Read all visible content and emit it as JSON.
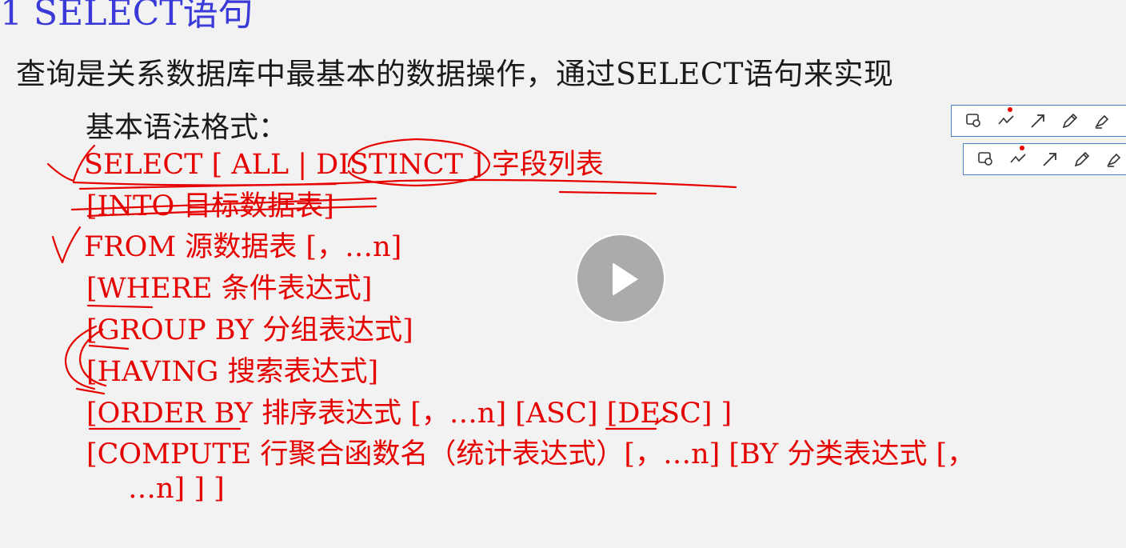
{
  "slide": {
    "title": "1 SELECT语句",
    "intro": "查询是关系数据库中最基本的数据操作，通过SELECT语句来实现",
    "subhead": "基本语法格式：",
    "syntax_lines": [
      "SELECT [ ALL | DISTINCT ] 字段列表",
      "[INTO 目标数据表]",
      "FROM 源数据表 [，…n]",
      "[WHERE 条件表达式]",
      "[GROUP BY 分组表达式]",
      "[HAVING 搜索表达式]",
      "[ORDER BY 排序表达式 [，…n] [ASC] [DESC] ]",
      "[COMPUTE 行聚合函数名（统计表达式）[，…n] [BY 分类表达式 [，",
      "…n] ] ]"
    ]
  },
  "colors": {
    "title": "#3a3ad8",
    "body_text": "#1a1a1a",
    "syntax": "#e60000",
    "ink": "#e60000",
    "toolbar_border": "#4a7ec0"
  },
  "player": {
    "play_icon": "play-icon"
  },
  "toolbars": [
    {
      "tools": [
        "lasso-select-icon",
        "curve-pen-icon",
        "arrow-icon",
        "pencil-icon",
        "highlighter-icon",
        "eraser-icon"
      ]
    },
    {
      "tools": [
        "lasso-select-icon",
        "curve-pen-icon",
        "arrow-icon",
        "pencil-icon",
        "highlighter-icon"
      ]
    }
  ]
}
